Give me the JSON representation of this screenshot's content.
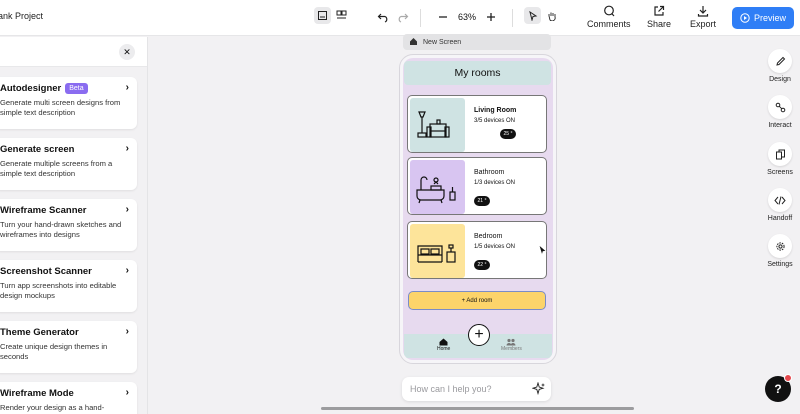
{
  "project_title": "ank Project",
  "toolbar": {
    "zoom": "63%",
    "comments": "Comments",
    "share": "Share",
    "export": "Export",
    "preview": "Preview"
  },
  "left_panel": {
    "items": [
      {
        "title": "Autodesigner",
        "badge": "Beta",
        "desc": "Generate multi screen designs from simple text description"
      },
      {
        "title": "Generate screen",
        "desc": "Generate multiple screens from a simple text description"
      },
      {
        "title": "Wireframe Scanner",
        "desc": "Turn your hand-drawn sketches and wireframes into designs"
      },
      {
        "title": "Screenshot Scanner",
        "desc": "Turn app screenshots into editable design mockups"
      },
      {
        "title": "Theme Generator",
        "desc": "Create unique design themes in seconds"
      },
      {
        "title": "Wireframe Mode",
        "desc": "Render your design as a hand-"
      }
    ]
  },
  "canvas": {
    "screen_name": "New Screen",
    "header": "My rooms",
    "rooms": [
      {
        "name": "Living Room",
        "devices": "3/5 devices ON",
        "temp": "25 °"
      },
      {
        "name": "Bathroom",
        "devices": "1/3 devices ON",
        "temp": "21 °"
      },
      {
        "name": "Bedroom",
        "devices": "1/5 devices ON",
        "temp": "22 °"
      }
    ],
    "add_room": "+ Add room",
    "tabs": {
      "home": "Home",
      "members": "Members"
    },
    "ask_placeholder": "How can I help you?"
  },
  "right_panel": {
    "design": "Design",
    "interact": "Interact",
    "screens": "Screens",
    "handoff": "Handoff",
    "settings": "Settings"
  },
  "help": "?",
  "colors": {
    "accent": "#2f7ef6",
    "beta": "#8a6cf0",
    "room_living": "#cfe3e3",
    "room_bath": "#d8c5f1",
    "room_bed": "#fde49a",
    "add_room": "#fcd46a"
  }
}
